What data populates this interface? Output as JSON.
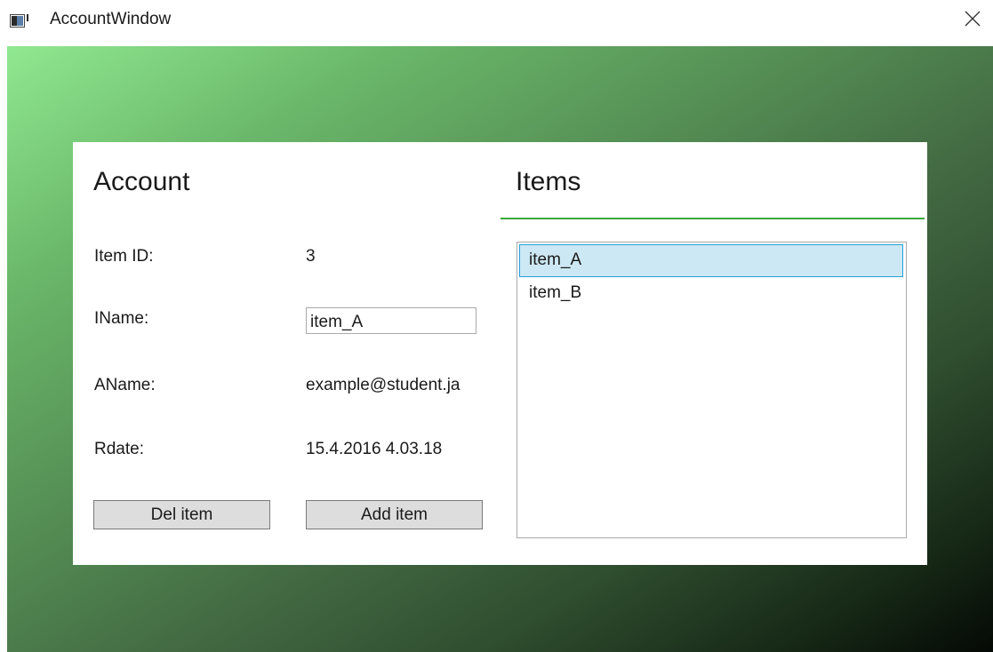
{
  "window": {
    "title": "AccountWindow"
  },
  "account": {
    "heading": "Account",
    "fields": {
      "item_id": {
        "label": "Item ID:",
        "value": "3"
      },
      "iname": {
        "label": "IName:",
        "value": "item_A"
      },
      "aname": {
        "label": "AName:",
        "value": "example@student.ja"
      },
      "rdate": {
        "label": "Rdate:",
        "value": "15.4.2016 4.03.18"
      }
    },
    "buttons": {
      "del": "Del item",
      "add": "Add item"
    }
  },
  "items": {
    "heading": "Items",
    "list": [
      {
        "label": "item_A",
        "selected": true
      },
      {
        "label": "item_B",
        "selected": false
      }
    ]
  },
  "colors": {
    "accent_underline": "#3aa83a",
    "selection_fill": "#cce8f4",
    "selection_border": "#26a0da",
    "gradient_start": "#90e890",
    "gradient_end": "#050905"
  }
}
